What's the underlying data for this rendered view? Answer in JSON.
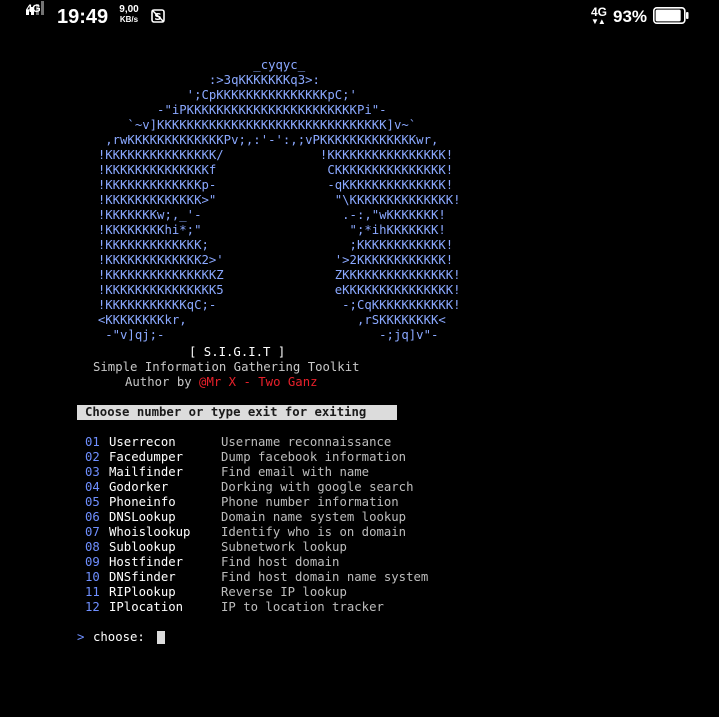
{
  "status_bar": {
    "network_left": "4G",
    "time": "19:49",
    "speed_value": "9,00",
    "speed_unit": "KB/s",
    "network_right": "4G",
    "battery_percent": "93%",
    "battery_level": 0.93,
    "icon_signal": "signal-bars-icon",
    "icon_screenshot": "crossed-s-icon",
    "icon_battery": "battery-icon"
  },
  "ascii_art": [
    "                            _cyqyc_",
    "                      :>3qKKKKKKKq3>:",
    "                   ';CpKKKKKKKKKKKKKKKpC;'",
    "               -\"iPKKKKKKKKKKKKKKKKKKKKKKKPi\"-",
    "           `~v]KKKKKKKKKKKKKKKKKKKKKKKKKKKKKKK]v~`",
    "        ,rwKKKKKKKKKKKKKPv;,:'-':,;vPKKKKKKKKKKKKKwr,",
    "       !KKKKKKKKKKKKKKK/             !KKKKKKKKKKKKKKKK!",
    "       !KKKKKKKKKKKKKKf               CKKKKKKKKKKKKKKK!",
    "       !KKKKKKKKKKKKKp-               -qKKKKKKKKKKKKKK!",
    "       !KKKKKKKKKKKKK>\"                \"\\KKKKKKKKKKKKKK!",
    "       !KKKKKKKw;,_'-                   .-:,\"wKKKKKKK!",
    "       !KKKKKKKKhi*;\"                    \";*ihKKKKKKK!",
    "       !KKKKKKKKKKKKK;                   ;KKKKKKKKKKKK!",
    "       !KKKKKKKKKKKKK2>'               '>2KKKKKKKKKKKK!",
    "       !KKKKKKKKKKKKKKKZ               ZKKKKKKKKKKKKKKK!",
    "       !KKKKKKKKKKKKKKK5               eKKKKKKKKKKKKKKK!",
    "       !KKKKKKKKKKKqC;-                 -;CqKKKKKKKKKKK!",
    "       <KKKKKKKKkr,                       ,rSKKKKKKKK<",
    "        -\"v]qj;-                             -;jq]v\"-"
  ],
  "banner": {
    "title": "[ S.I.G.I.T ]",
    "subtitle": "Simple Information Gathering Toolkit",
    "author_label": "Author by ",
    "author_name": "@Mr X - Two Ganz"
  },
  "prompt_bar_text": "Choose number or type exit for exiting",
  "menu": [
    {
      "num": "01",
      "name": "Userrecon",
      "desc": "Username reconnaissance"
    },
    {
      "num": "02",
      "name": "Facedumper",
      "desc": "Dump facebook information"
    },
    {
      "num": "03",
      "name": "Mailfinder",
      "desc": "Find email with name"
    },
    {
      "num": "04",
      "name": "Godorker",
      "desc": "Dorking with google search"
    },
    {
      "num": "05",
      "name": "Phoneinfo",
      "desc": "Phone number information"
    },
    {
      "num": "06",
      "name": "DNSLookup",
      "desc": "Domain name system lookup"
    },
    {
      "num": "07",
      "name": "Whoislookup",
      "desc": "Identify who is on domain"
    },
    {
      "num": "08",
      "name": "Sublookup",
      "desc": "Subnetwork lookup"
    },
    {
      "num": "09",
      "name": "Hostfinder",
      "desc": "Find host domain"
    },
    {
      "num": "10",
      "name": "DNSfinder",
      "desc": "Find host domain name system"
    },
    {
      "num": "11",
      "name": "RIPlookup",
      "desc": "Reverse IP lookup"
    },
    {
      "num": "12",
      "name": "IPlocation",
      "desc": "IP to location tracker"
    }
  ],
  "input": {
    "caret": ">",
    "label": "choose:",
    "value": ""
  },
  "colors": {
    "background": "#000000",
    "ascii": "#8aa8ff",
    "menu_number": "#6f8fff",
    "author_name": "#e8202a",
    "prompt_bar": "#dcdcdc"
  }
}
